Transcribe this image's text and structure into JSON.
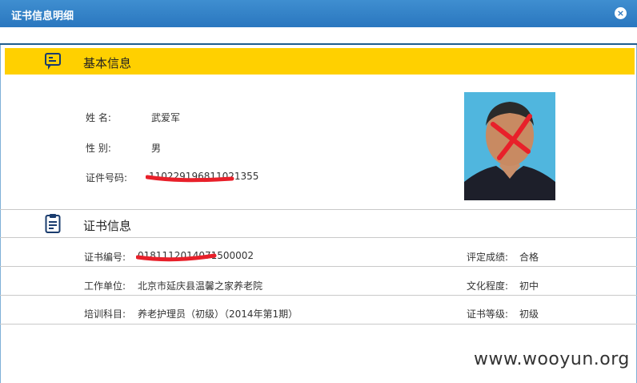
{
  "window": {
    "title": "证书信息明细"
  },
  "basic": {
    "title": "基本信息",
    "name_label": "姓 名:",
    "name_value": "武爱军",
    "gender_label": "性 别:",
    "gender_value": "男",
    "id_label": "证件号码:",
    "id_value": "110229196811021355"
  },
  "cert": {
    "title": "证书信息",
    "number_label": "证书编号:",
    "number_value": "0181112014071500002",
    "result_label": "评定成绩:",
    "result_value": "合格",
    "work_label": "工作单位:",
    "work_value": "北京市延庆县温馨之家养老院",
    "edu_label": "文化程度:",
    "edu_value": "初中",
    "subject_label": "培训科目:",
    "subject_value": "养老护理员（初级）（2014年第1期）",
    "level_label": "证书等级:",
    "level_value": "初级"
  },
  "watermark": "www.wooyun.org",
  "colors": {
    "titlebar": "#2a77bf",
    "section_bar": "#ffd000",
    "redaction": "#e8202a"
  }
}
